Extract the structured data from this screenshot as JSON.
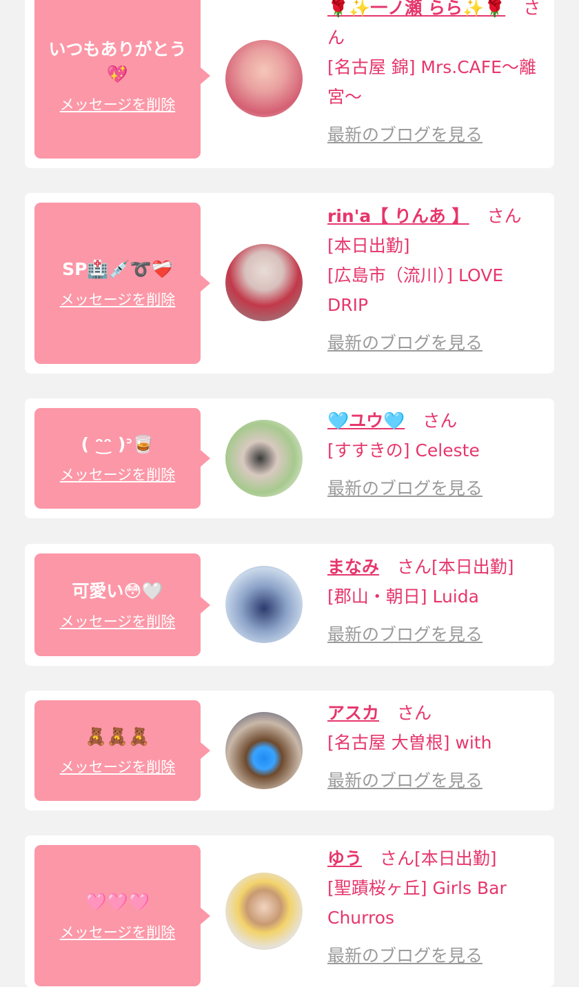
{
  "delete_label": "メッセージを削除",
  "blog_label": "最新のブログを見る",
  "san_label": "さん",
  "colors": {
    "background": "#f2f2f2",
    "card": "#ffffff",
    "bubble": "#fc97a7",
    "accent": "#e6366c",
    "muted": "#9a9a9a"
  },
  "entries": [
    {
      "message": "いつもありがとう\n💖",
      "name": "🌹✨一ノ瀬 らら✨🌹",
      "status": "",
      "shop": "[名古屋 錦] Mrs.CAFE〜離宮〜"
    },
    {
      "message": "SP🏥💉➰❤️‍🩹",
      "name": "rin'a【 りんあ 】",
      "status": "[本日出勤]",
      "shop": "[広島市（流川）] LOVE DRIP"
    },
    {
      "message": "( ᵔ͜ᵔ )ᐣ🥃",
      "name": "🩵ユウ🩵",
      "status": "",
      "shop": "[すすきの] Celeste"
    },
    {
      "message": "可愛い😳🤍",
      "name": "まなみ",
      "status": "[本日出勤]",
      "shop": "[郡山・朝日] Luida"
    },
    {
      "message": "🧸🧸🧸",
      "name": "アスカ",
      "status": "",
      "shop": "[名古屋 大曽根] with"
    },
    {
      "message": "🩷🩷🩷",
      "name": "ゆう",
      "status": "[本日出勤]",
      "shop": "[聖蹟桜ヶ丘] Girls Bar Churros"
    }
  ]
}
